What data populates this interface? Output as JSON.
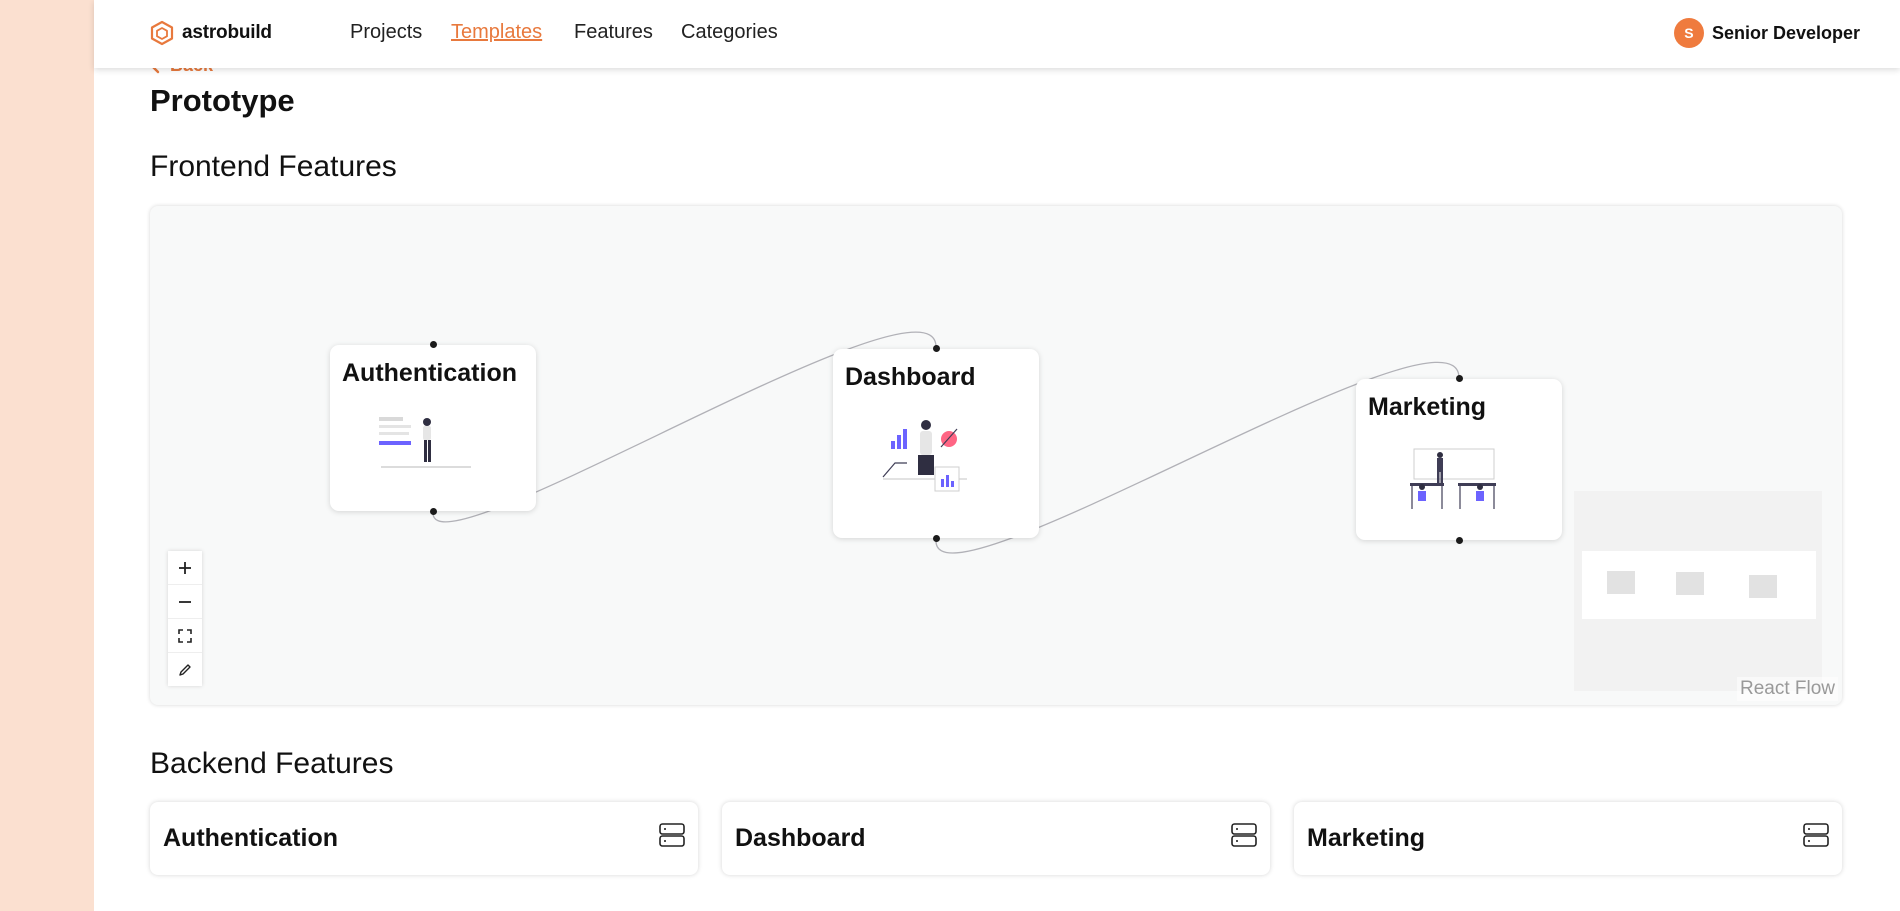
{
  "brand": {
    "name": "astrobuild",
    "accent": "#e8793d"
  },
  "nav": {
    "links": [
      "Projects",
      "Templates",
      "Features",
      "Categories"
    ],
    "active": "Templates"
  },
  "user": {
    "initial": "S",
    "name": "Senior Developer"
  },
  "back_label": "Back",
  "page_title": "Prototype",
  "frontend": {
    "title": "Frontend Features",
    "nodes": [
      {
        "label": "Authentication",
        "illustration": "login-form-illustration"
      },
      {
        "label": "Dashboard",
        "illustration": "analytics-dashboard-illustration"
      },
      {
        "label": "Marketing",
        "illustration": "team-meeting-illustration"
      }
    ],
    "controls": [
      "zoom-in-icon",
      "zoom-out-icon",
      "fit-view-icon",
      "lock-icon"
    ],
    "attribution": "React Flow"
  },
  "backend": {
    "title": "Backend Features",
    "cards": [
      {
        "label": "Authentication",
        "icon": "server-icon"
      },
      {
        "label": "Dashboard",
        "icon": "server-icon"
      },
      {
        "label": "Marketing",
        "icon": "server-icon"
      }
    ]
  }
}
